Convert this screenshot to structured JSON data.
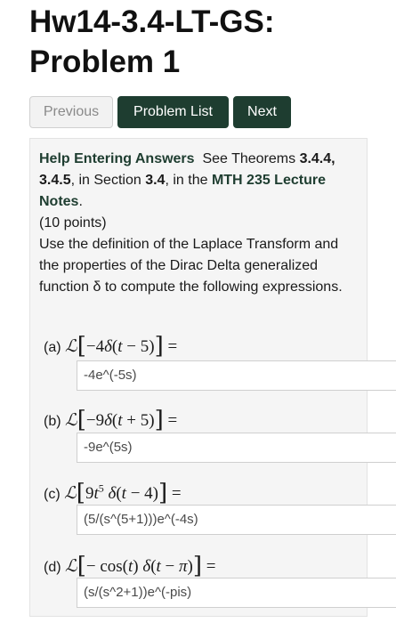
{
  "page_title_line1": "Hw14-3.4-LT-GS:",
  "page_title_line2": "Problem 1",
  "nav": {
    "previous": "Previous",
    "problem_list": "Problem List",
    "next": "Next"
  },
  "help": {
    "label": "Help Entering Answers",
    "see": "See Theorems",
    "theorems": "3.4.4, 3.4.5",
    "in_section": "in Section",
    "section": "3.4",
    "in_the": "in the",
    "notes_link": "MTH 235 Lecture Notes"
  },
  "points": "(10 points)",
  "instructions": "Use the definition of the Laplace Transform and the properties of the Dirac Delta generalized function δ to compute the following expressions.",
  "parts": [
    {
      "label": "(a)",
      "answer": "-4e^(-5s)"
    },
    {
      "label": "(b)",
      "answer": "-9e^(5s)"
    },
    {
      "label": "(c)",
      "answer": "(5/(s^(5+1)))e^(-4s)"
    },
    {
      "label": "(d)",
      "answer": "(s/(s^2+1))e^(-pis)"
    }
  ]
}
